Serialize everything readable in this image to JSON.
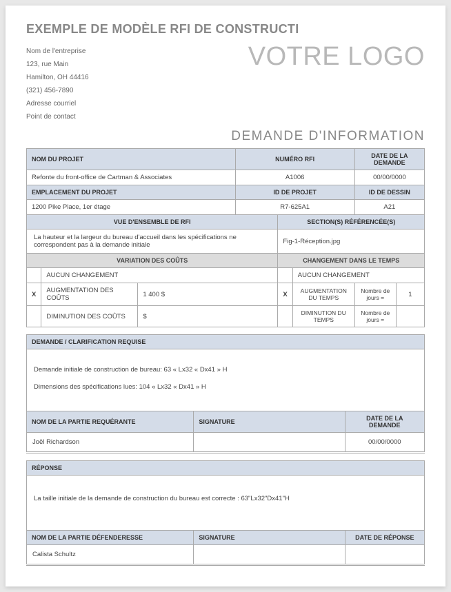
{
  "title": "EXEMPLE DE MODÈLE RFI DE CONSTRUCTI",
  "company": {
    "name": "Nom de l'entreprise",
    "address1": "123, rue Main",
    "address2": "Hamilton, OH 44416",
    "phone": "(321) 456-7890",
    "email": "Adresse courriel",
    "contact": "Point de contact"
  },
  "logo": "VOTRE LOGO",
  "subtitle": "DEMANDE D'INFORMATION",
  "labels": {
    "project_name": "NOM DU PROJET",
    "rfi_number": "NUMÉRO RFI",
    "request_date": "DATE DE LA DEMANDE",
    "project_location": "EMPLACEMENT DU PROJET",
    "project_id": "ID DE PROJET",
    "drawing_id": "ID DE DESSIN",
    "rfi_overview": "VUE D'ENSEMBLE DE RFI",
    "ref_sections": "SECTION(S) RÉFÉRENCÉE(S)",
    "cost_variation": "VARIATION DES COÛTS",
    "time_change": "CHANGEMENT DANS LE TEMPS",
    "no_change": "AUCUN CHANGEMENT",
    "cost_increase": "AUGMENTATION DES COÛTS",
    "cost_decrease": "DIMINUTION DES COÛTS",
    "time_increase": "AUGMENTATION DU TEMPS",
    "time_decrease": "DIMINUTION DU TEMPS",
    "days_label": "Nombre de jours =",
    "request_clarification": "DEMANDE / CLARIFICATION REQUISE",
    "requesting_party": "NOM DE LA PARTIE REQUÉRANTE",
    "signature": "SIGNATURE",
    "response": "RÉPONSE",
    "defending_party": "NOM DE LA PARTIE DÉFENDERESSE",
    "response_date": "DATE DE RÉPONSE"
  },
  "values": {
    "project_name": "Refonte du front-office de Cartman & Associates",
    "rfi_number": "A1006",
    "request_date": "00/00/0000",
    "project_location": "1200 Pike Place, 1er étage",
    "project_id": "R7-625A1",
    "drawing_id": "A21",
    "rfi_overview": "La hauteur et la largeur du bureau d'accueil dans les spécifications ne correspondent pas à la demande initiale",
    "ref_sections": "Fig-1-Réception.jpg",
    "cost_x1": "",
    "cost_x2": "X",
    "cost_x3": "",
    "cost_increase_val": "1 400 $",
    "cost_decrease_val": "$",
    "time_x1": "",
    "time_x2": "X",
    "time_x3": "",
    "time_increase_val": "1",
    "time_decrease_val": "",
    "request_text1": "Demande initiale de construction de bureau: 63 « Lx32 « Dx41 » H",
    "request_text2": "Dimensions des spécifications lues: 104 « Lx32 « Dx41 » H",
    "requesting_party": "Joël Richardson",
    "response_text": "La taille initiale de la demande de construction du bureau est correcte : 63\"Lx32\"Dx41\"H",
    "defending_party": "Calista Schultz",
    "response_date": ""
  }
}
